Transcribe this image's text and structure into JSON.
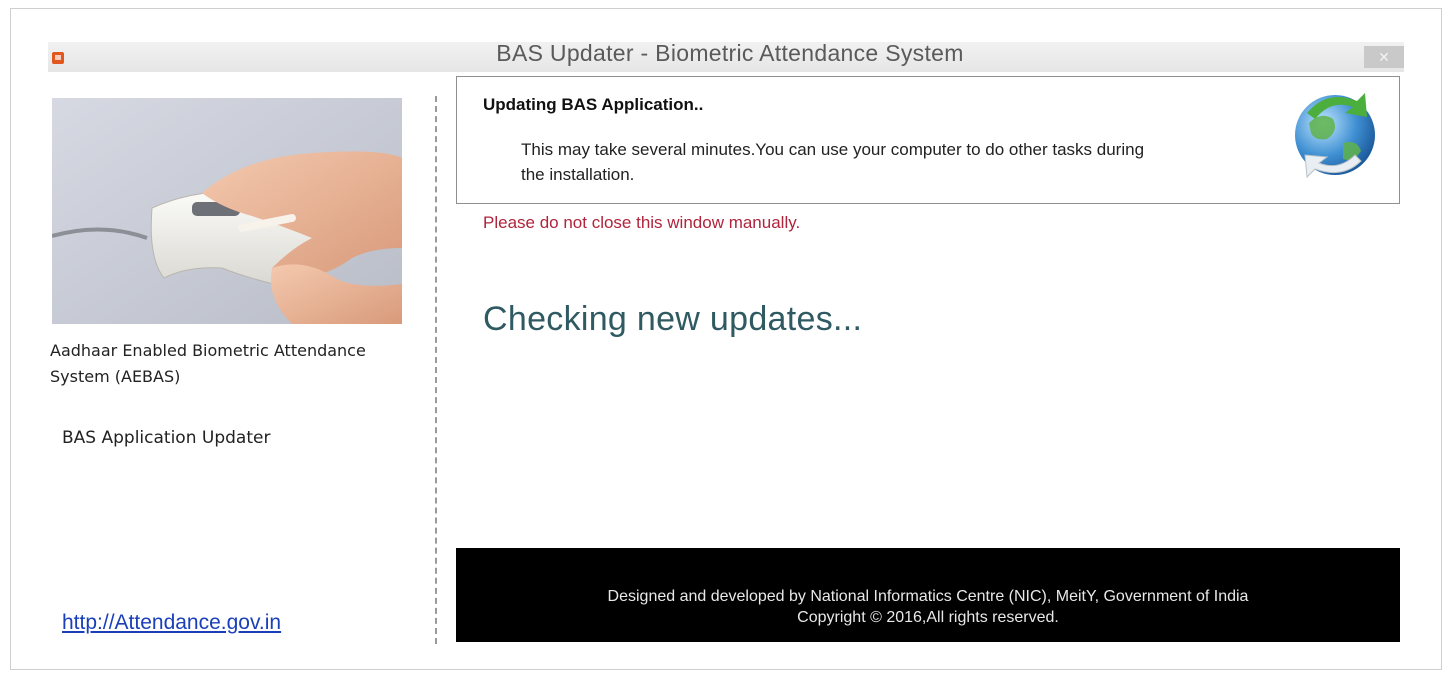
{
  "window": {
    "title": "BAS Updater - Biometric Attendance System",
    "close_label": "✕"
  },
  "sidebar": {
    "system_name": "Aadhaar Enabled Biometric Attendance System (AEBAS)",
    "app_name": "BAS Application Updater",
    "link": "http://Attendance.gov.in"
  },
  "header": {
    "title": "Updating BAS Application..",
    "description": "This may take several minutes.You can use your computer to do other tasks during the installation."
  },
  "main": {
    "warning": "Please do not close this window manually.",
    "status": "Checking new updates..."
  },
  "footer": {
    "line1": "Designed and developed by National Informatics Centre (NIC), MeitY, Government of India",
    "line2": "Copyright © 2016,All rights reserved."
  },
  "colors": {
    "warning": "#b0243c",
    "status": "#2f5a62",
    "link": "#1a3fb8",
    "footer_bg": "#000000"
  }
}
